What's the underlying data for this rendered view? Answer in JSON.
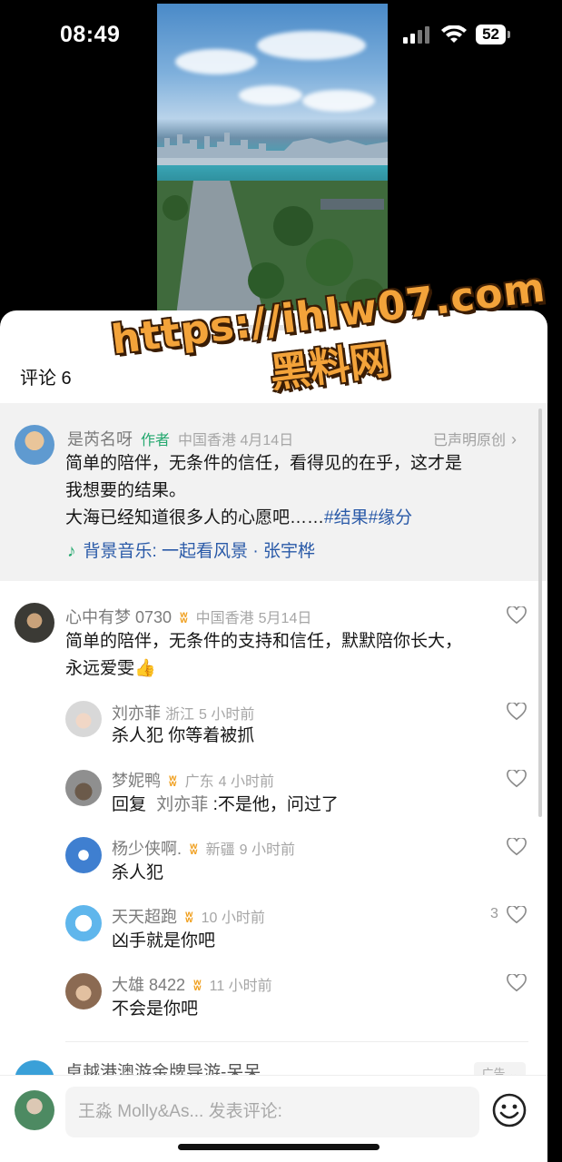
{
  "status_bar": {
    "time": "08:49",
    "battery": "52"
  },
  "comments": {
    "title": "评论 6",
    "author_comment": {
      "username": "是芮名呀",
      "tag": "作者",
      "location_time": "中国香港 4月14日",
      "original_label": "已声明原创",
      "lines": [
        "简单的陪伴，无条件的信任，看得见的在乎，这才是",
        "我想要的结果。"
      ],
      "line3_text": "大海已经知道很多人的心愿吧……",
      "hashtags": "#结果#缘分",
      "music": "背景音乐: 一起看风景 · 张宇桦"
    },
    "items": [
      {
        "username": "心中有梦 0730",
        "location": "中国香港",
        "time": "5月14日",
        "text_1": "简单的陪伴，无条件的支持和信任，默默陪你长大，",
        "text_2": "永远爱雯👍"
      },
      {
        "username": "刘亦菲",
        "location": "浙江",
        "time": "5 小时前",
        "text": "杀人犯 你等着被抓"
      },
      {
        "username": "梦妮鸭",
        "location": "广东",
        "time": "4 小时前",
        "reply_prefix": "回复",
        "reply_to": "刘亦菲",
        "text": ":不是他，问过了"
      },
      {
        "username": "杨少侠啊.",
        "location": "新疆",
        "time": "9 小时前",
        "text": "杀人犯"
      },
      {
        "username": "天天超跑",
        "location": "",
        "time": "10 小时前",
        "text": "凶手就是你吧",
        "likes": "3"
      },
      {
        "username": "大雄 8422",
        "location": "",
        "time": "11 小时前",
        "text": "不会是你吧"
      }
    ],
    "ad": {
      "text": "卓越港澳游金牌导游-呆呆",
      "badge": "广告 ⌄"
    }
  },
  "watermark": {
    "url": "https://ihlw07.com",
    "name": "黑料网"
  },
  "input": {
    "placeholder": "王淼 Molly&As... 发表评论:"
  },
  "colors": {
    "author_green": "#23a86e",
    "link_blue": "#2a5aa8",
    "badge_gold": "#f0a020"
  }
}
